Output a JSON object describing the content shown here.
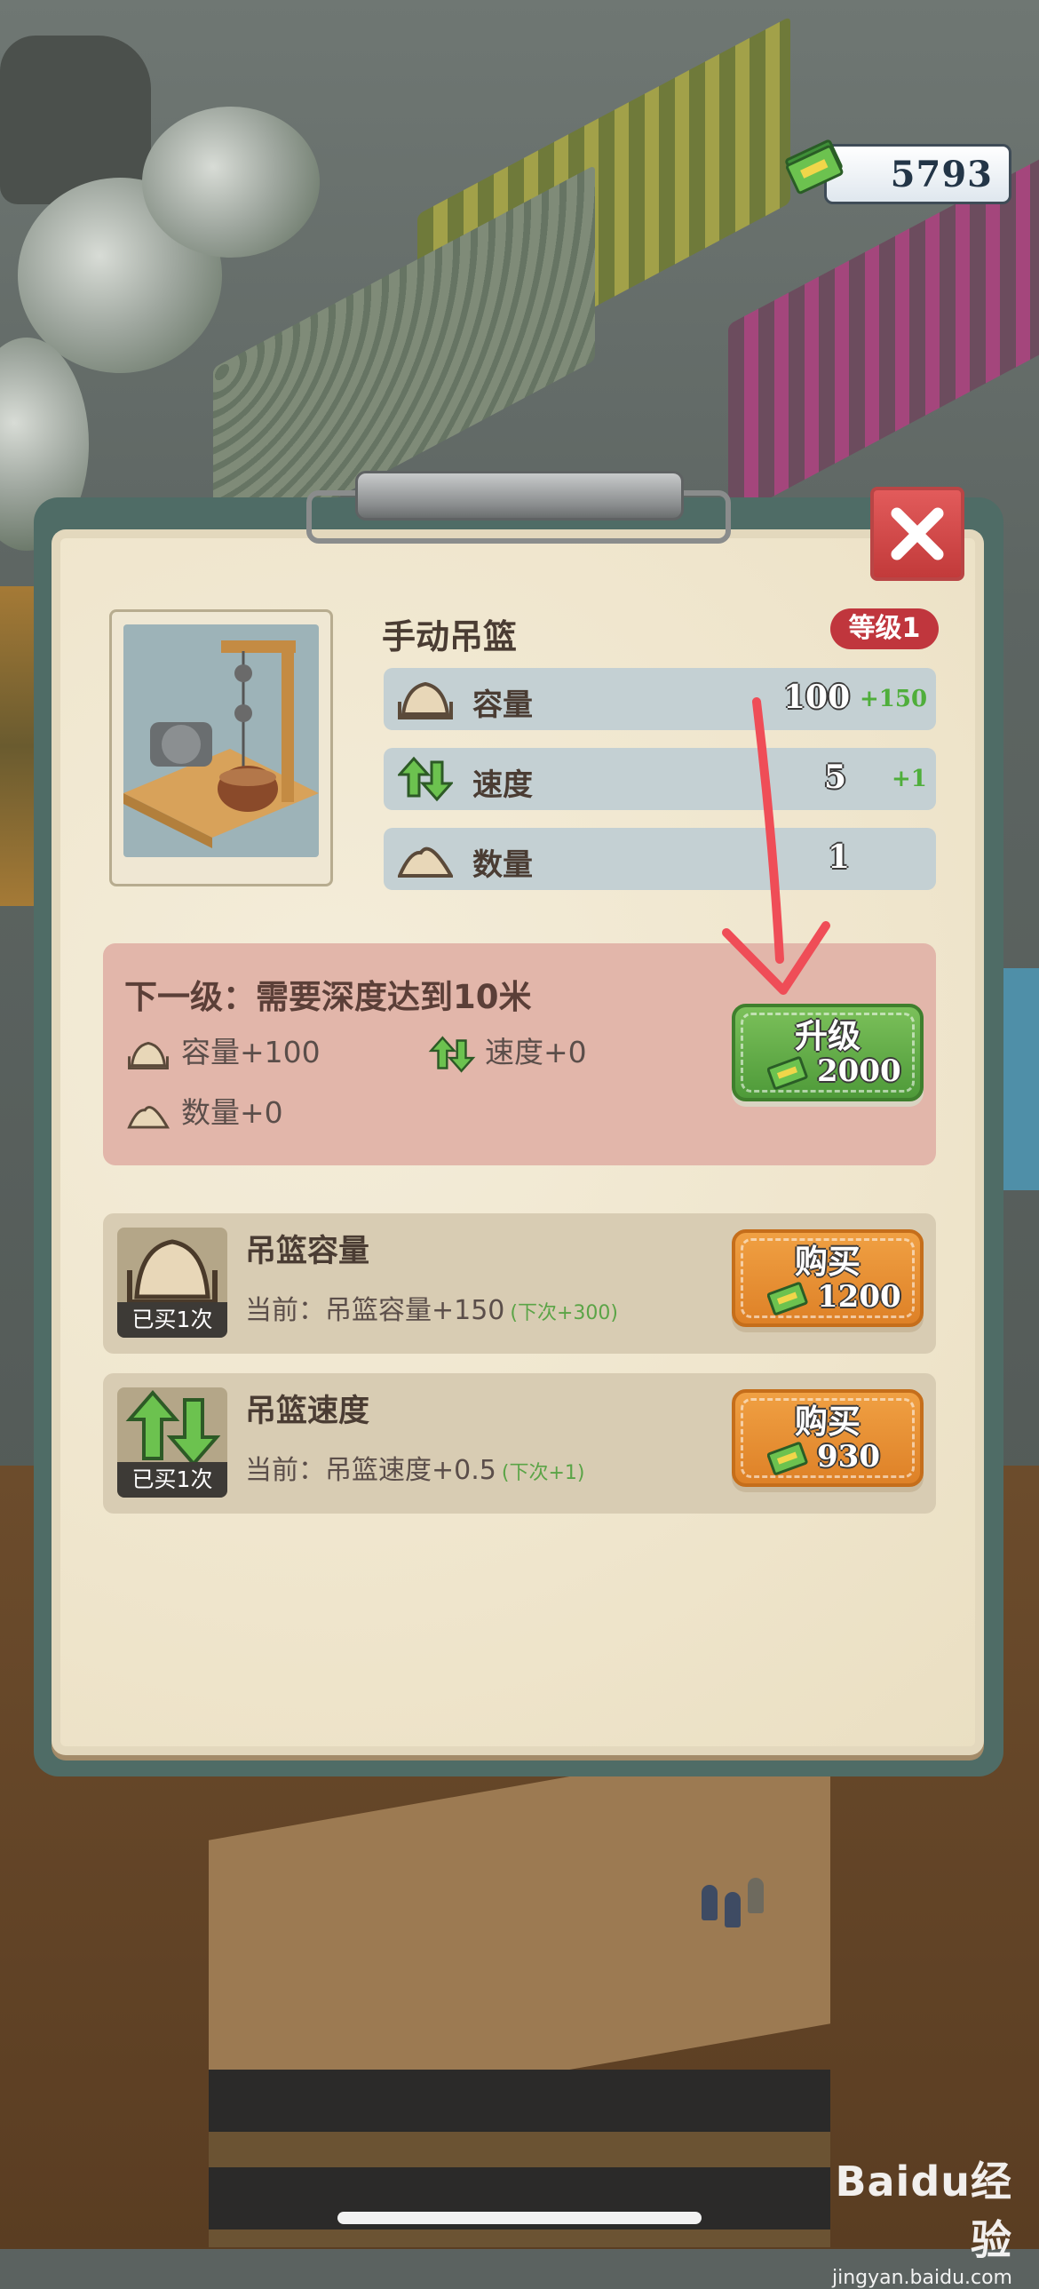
{
  "currency": {
    "value": "5793"
  },
  "item": {
    "name": "手动吊篮",
    "level_badge": "等级1",
    "stats": [
      {
        "icon": "sand-pile-icon",
        "label": "容量",
        "value": "100",
        "bonus": "+150"
      },
      {
        "icon": "up-down-arrows-icon",
        "label": "速度",
        "value": "5",
        "bonus": "+1"
      },
      {
        "icon": "mound-icon",
        "label": "数量",
        "value": "1",
        "bonus": ""
      }
    ]
  },
  "next_level": {
    "title": "下一级：需要深度达到10米",
    "capacity": "容量+100",
    "speed": "速度+0",
    "quantity": "数量+0",
    "upgrade_label": "升级",
    "upgrade_price": "2000"
  },
  "purchases": [
    {
      "title": "吊篮容量",
      "bought": "已买1次",
      "current": "当前：吊篮容量+150",
      "next": "(下次+300)",
      "button_label": "购买",
      "price": "1200",
      "icon": "basket-sand-icon"
    },
    {
      "title": "吊篮速度",
      "bought": "已买1次",
      "current": "当前：吊篮速度+0.5",
      "next": "(下次+1)",
      "button_label": "购买",
      "price": "930",
      "icon": "up-down-arrows-icon"
    }
  ],
  "watermark": {
    "logo": "Baidu经验",
    "url": "jingyan.baidu.com"
  },
  "colors": {
    "level_badge": "#c0363d",
    "upgrade_button": "#5aa73f",
    "buy_button": "#e8902f",
    "close_button": "#d24a4a",
    "arrow": "#ef4d57"
  }
}
